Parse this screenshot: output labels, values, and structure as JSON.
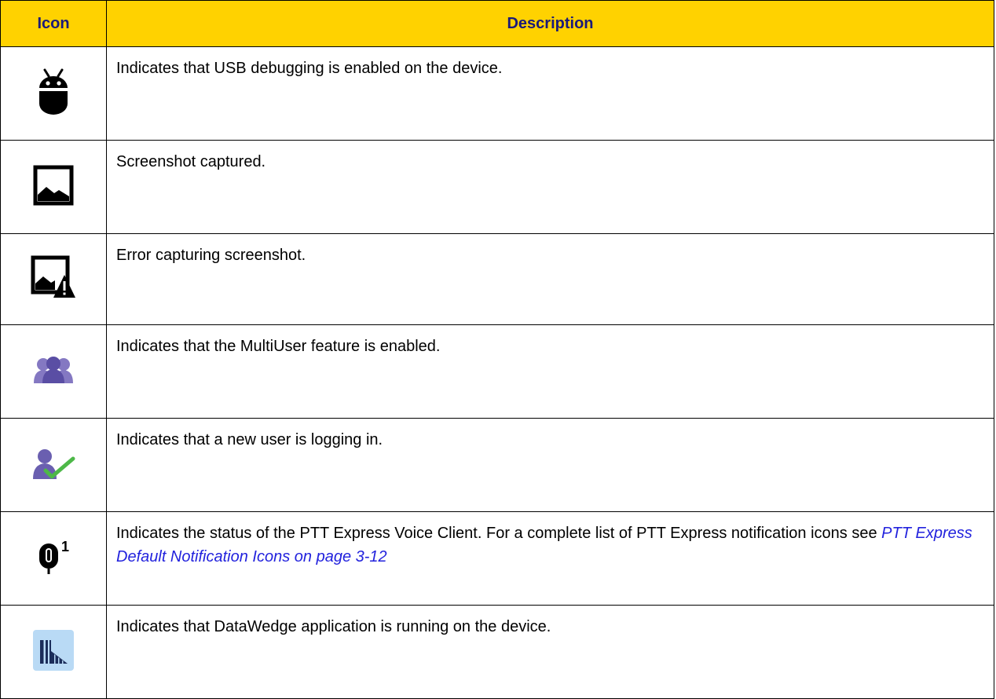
{
  "table": {
    "header": {
      "icon": "Icon",
      "description": "Description"
    },
    "rows": [
      {
        "icon": "android-debug-icon",
        "text": "Indicates that USB debugging is enabled on the device."
      },
      {
        "icon": "screenshot-captured-icon",
        "text": "Screenshot captured."
      },
      {
        "icon": "screenshot-error-icon",
        "text": "Error capturing screenshot."
      },
      {
        "icon": "multiuser-icon",
        "text": "Indicates that the MultiUser feature is enabled."
      },
      {
        "icon": "user-login-icon",
        "text": "Indicates that a new user is logging in."
      },
      {
        "icon": "ptt-express-icon",
        "icon_superscript": "1",
        "text": "Indicates the status of the PTT Express Voice Client. For a complete list of PTT Express notification icons see ",
        "link": "PTT Express Default Notification Icons on page 3-12"
      },
      {
        "icon": "datawedge-icon",
        "text": "Indicates that DataWedge application is running on the device."
      }
    ]
  },
  "colors": {
    "header_bg": "#ffd200",
    "header_text": "#1a1a7a",
    "link": "#2222dd",
    "multiuser_purple": "#6a5fb0",
    "check_green": "#4db848",
    "datawedge_bg": "#b9daf5"
  }
}
